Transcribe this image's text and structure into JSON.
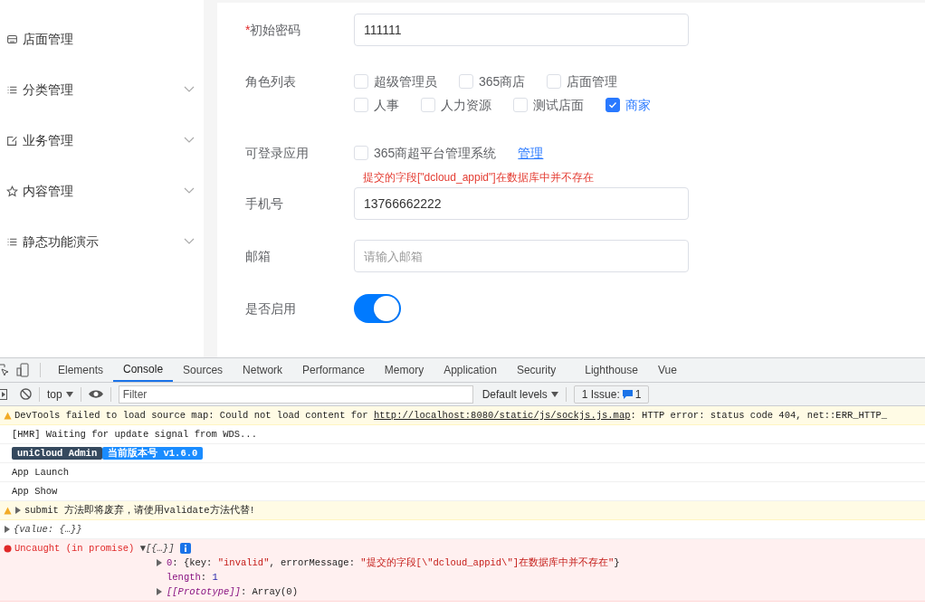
{
  "sidebar": {
    "items": [
      {
        "label": "店面管理",
        "kind": "link"
      },
      {
        "label": "分类管理",
        "kind": "submenu",
        "expanded": false
      },
      {
        "label": "业务管理",
        "kind": "submenu",
        "expanded": false
      },
      {
        "label": "内容管理",
        "kind": "submenu",
        "expanded": false
      },
      {
        "label": "静态功能演示",
        "kind": "submenu",
        "expanded": false
      }
    ]
  },
  "form": {
    "password": {
      "label": "初始密码",
      "required_mark": "*",
      "value": "111111"
    },
    "roles": {
      "label": "角色列表",
      "options": [
        {
          "label": "超级管理员",
          "checked": false
        },
        {
          "label": "365商店",
          "checked": false
        },
        {
          "label": "店面管理",
          "checked": false
        },
        {
          "label": "人事",
          "checked": false
        },
        {
          "label": "人力资源",
          "checked": false
        },
        {
          "label": "测试店面",
          "checked": false
        },
        {
          "label": "商家",
          "checked": true
        }
      ]
    },
    "apps": {
      "label": "可登录应用",
      "option": {
        "label": "365商超平台管理系统",
        "checked": false
      },
      "link": "管理",
      "error": "提交的字段[\"dcloud_appid\"]在数据库中并不存在"
    },
    "phone": {
      "label": "手机号",
      "value": "13766662222"
    },
    "email": {
      "label": "邮箱",
      "placeholder": "请输入邮箱"
    },
    "enabled": {
      "label": "是否启用",
      "on": true
    }
  },
  "devtools": {
    "tabs": [
      {
        "label": "Elements",
        "selected": false
      },
      {
        "label": "Console",
        "selected": true
      },
      {
        "label": "Sources",
        "selected": false
      },
      {
        "label": "Network",
        "selected": false
      },
      {
        "label": "Performance",
        "selected": false
      },
      {
        "label": "Memory",
        "selected": false
      },
      {
        "label": "Application",
        "selected": false
      },
      {
        "label": "Security",
        "selected": false
      },
      {
        "label": "Lighthouse",
        "selected": false
      },
      {
        "label": "Vue",
        "selected": false
      }
    ],
    "context": "top",
    "filter_placeholder": "Filter",
    "levels": "Default levels",
    "issues": {
      "label": "1 Issue:",
      "count": "1"
    },
    "messages": [
      {
        "kind": "warning",
        "segments": [
          {
            "kind": "plain",
            "text": "DevTools failed to load source map: Could not load content for "
          },
          {
            "kind": "link",
            "text": "http://localhost:8080/static/js/sockjs.js.map"
          },
          {
            "kind": "plain",
            "text": ": HTTP error: status code 404, net::ERR_HTTP_"
          }
        ]
      },
      {
        "kind": "log",
        "segments": [
          {
            "kind": "plain",
            "text": "[HMR] Waiting for update signal from WDS..."
          }
        ]
      },
      {
        "kind": "badge",
        "badges": [
          "uniCloud Admin",
          "当前版本号 v1.6.0"
        ]
      },
      {
        "kind": "log",
        "segments": [
          {
            "kind": "plain",
            "text": "App Launch"
          }
        ]
      },
      {
        "kind": "log",
        "segments": [
          {
            "kind": "plain",
            "text": "App Show"
          }
        ]
      },
      {
        "kind": "warning",
        "expandable": true,
        "segments": [
          {
            "kind": "plain",
            "text": "submit 方法即将废弃，请使用validate方法代替!"
          }
        ]
      },
      {
        "kind": "log",
        "expandable": true,
        "segments": [
          {
            "kind": "italic",
            "text": "{value: {…}}"
          }
        ]
      },
      {
        "kind": "error",
        "segments": [
          {
            "kind": "error",
            "text": "Uncaught (in promise) "
          },
          {
            "kind": "italic",
            "text": "▼[{…}]"
          }
        ],
        "children": [
          {
            "expandable": true,
            "segments": [
              {
                "kind": "key",
                "text": "0"
              },
              {
                "kind": "plain",
                "text": ": {key: "
              },
              {
                "kind": "string",
                "text": "\"invalid\""
              },
              {
                "kind": "plain",
                "text": ", errorMessage: "
              },
              {
                "kind": "string",
                "text": "\"提交的字段[\\\"dcloud_appid\\\"]在数据库中并不存在\""
              },
              {
                "kind": "plain",
                "text": "}"
              }
            ]
          },
          {
            "expandable": false,
            "segments": [
              {
                "kind": "key",
                "text": "length"
              },
              {
                "kind": "plain",
                "text": ": "
              },
              {
                "kind": "number",
                "text": "1"
              }
            ]
          },
          {
            "expandable": true,
            "segments": [
              {
                "kind": "keyitalic",
                "text": "[[Prototype]]"
              },
              {
                "kind": "plain",
                "text": ": Array(0)"
              }
            ]
          }
        ]
      }
    ]
  }
}
